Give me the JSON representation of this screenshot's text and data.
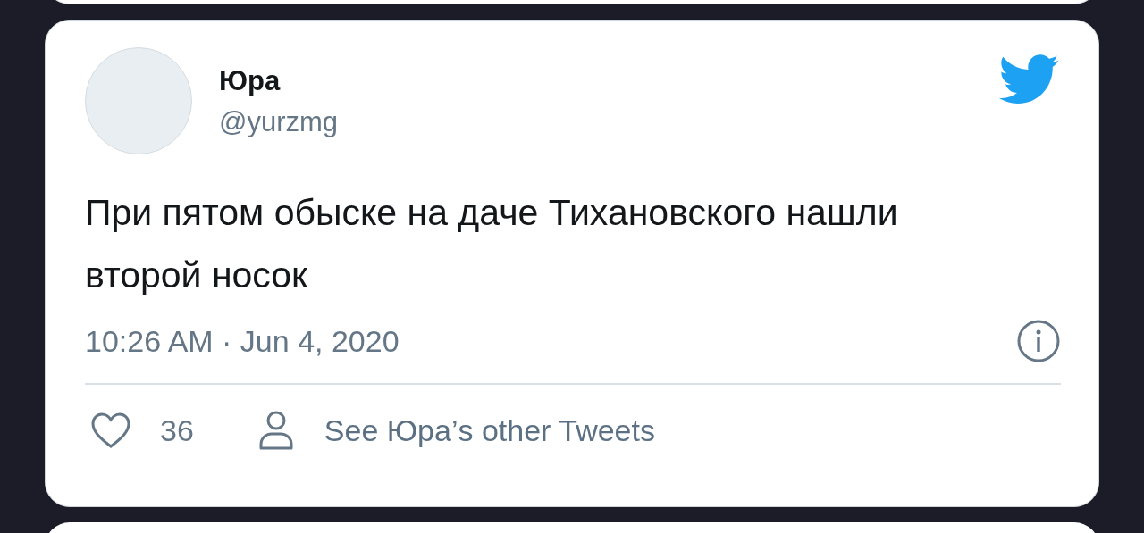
{
  "tweet": {
    "author": {
      "name": "Юра",
      "handle": "@yurzmg"
    },
    "text": "При пятом обыске на даче Тихановского нашли второй носок",
    "timestamp": "10:26 AM · Jun 4, 2020",
    "likes": "36",
    "other_tweets_link": "See Юра’s other Tweets"
  }
}
